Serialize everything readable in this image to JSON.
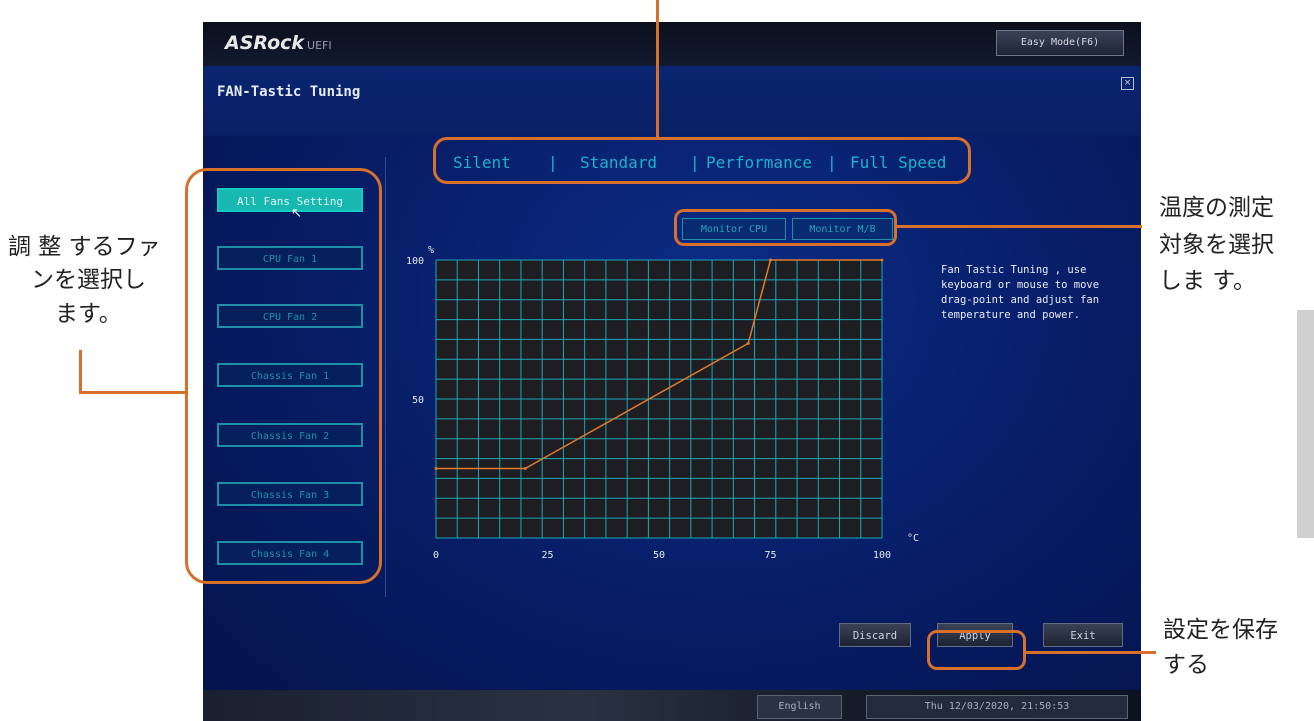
{
  "bios": {
    "brand": "ASRock",
    "brand_suffix": "UEFI",
    "easy_mode_label": "Easy Mode(F6)",
    "page_title": "FAN-Tastic Tuning",
    "close_glyph": "×",
    "modes": [
      "Silent",
      "Standard",
      "Performance",
      "Full Speed"
    ],
    "mode_separator": "|",
    "fans": [
      "All Fans Setting",
      "CPU Fan 1",
      "CPU Fan 2",
      "Chassis Fan 1",
      "Chassis Fan 2",
      "Chassis Fan 3",
      "Chassis Fan 4"
    ],
    "active_fan_index": 0,
    "monitor_buttons": [
      "Monitor CPU",
      "Monitor M/B"
    ],
    "description": "Fan Tastic Tuning , use keyboard or mouse to move drag-point and adjust fan temperature and power.",
    "buttons": {
      "discard": "Discard",
      "apply": "Apply",
      "exit": "Exit"
    },
    "language": "English",
    "datetime": "Thu 12/03/2020, 21:50:53"
  },
  "chart_data": {
    "type": "line",
    "y_unit": "%",
    "x_unit": "°C",
    "xlim": [
      0,
      100
    ],
    "ylim": [
      0,
      100
    ],
    "x_ticks": [
      "0",
      "25",
      "50",
      "75",
      "100"
    ],
    "y_ticks": [
      "100",
      "50"
    ],
    "grid": true,
    "series": [
      {
        "points": [
          [
            0,
            25
          ],
          [
            20,
            25
          ],
          [
            70,
            70
          ],
          [
            75,
            100
          ],
          [
            100,
            100
          ]
        ],
        "color": "#e07a2a"
      }
    ]
  },
  "annotations": {
    "fan_select": "調 整 するファンを選択します。",
    "fan_select_lines": [
      "調 整 するファ",
      "ンを選択し",
      "ます。"
    ],
    "monitor": [
      "温度の測定",
      "対象を選択",
      "しま す。"
    ],
    "save": [
      "設定を保存",
      "する"
    ]
  }
}
